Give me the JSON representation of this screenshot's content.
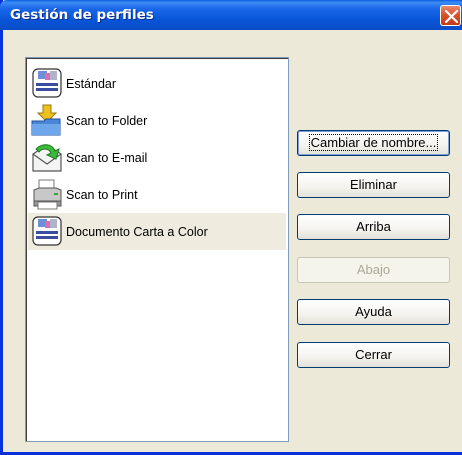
{
  "window": {
    "title": "Gestión de perfiles"
  },
  "profiles": [
    {
      "label": "Estándar",
      "icon": "organizer-profile-icon",
      "selected": false
    },
    {
      "label": "Scan to Folder",
      "icon": "folder-arrow-icon",
      "selected": false
    },
    {
      "label": "Scan to E-mail",
      "icon": "email-arrow-icon",
      "selected": false
    },
    {
      "label": "Scan to Print",
      "icon": "printer-icon",
      "selected": false
    },
    {
      "label": "Documento Carta a Color",
      "icon": "organizer-profile-icon",
      "selected": true
    }
  ],
  "buttons": {
    "rename": "Cambiar de nombre...",
    "delete": "Eliminar",
    "up": "Arriba",
    "down": "Abajo",
    "help": "Ayuda",
    "close": "Cerrar"
  },
  "colors": {
    "titlebar": "#0a5ee3",
    "selected_row": "#efebde",
    "dialog_bg": "#ece9d8",
    "close_button": "#d8502b"
  }
}
